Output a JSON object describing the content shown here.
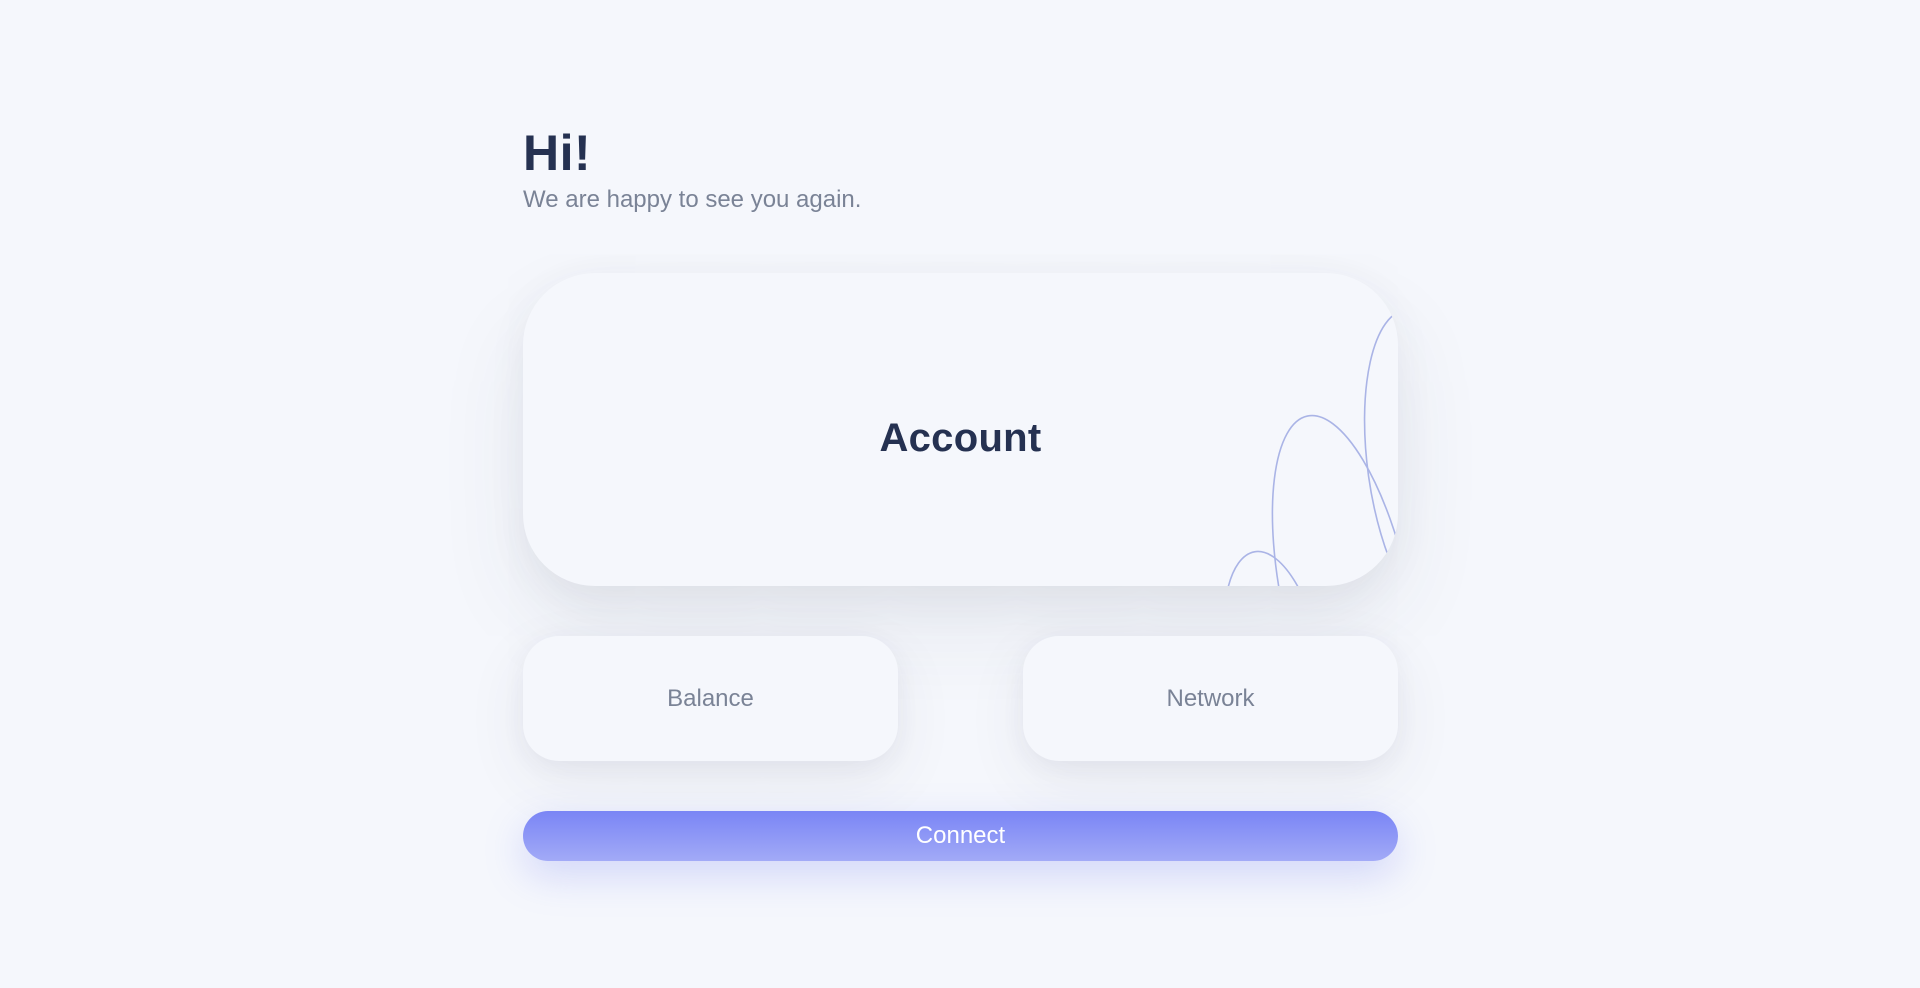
{
  "header": {
    "title": "Hi!",
    "subtitle": "We are happy to see you again."
  },
  "account_card": {
    "label": "Account"
  },
  "balance_card": {
    "label": "Balance"
  },
  "network_card": {
    "label": "Network"
  },
  "connect_button": {
    "label": "Connect"
  },
  "colors": {
    "background": "#f5f7fc",
    "heading": "#253151",
    "muted_text": "#7a8396",
    "accent_top": "#7a85f5",
    "accent_bottom": "#a2aaf7",
    "decoration_lines": "#aab4e6"
  }
}
